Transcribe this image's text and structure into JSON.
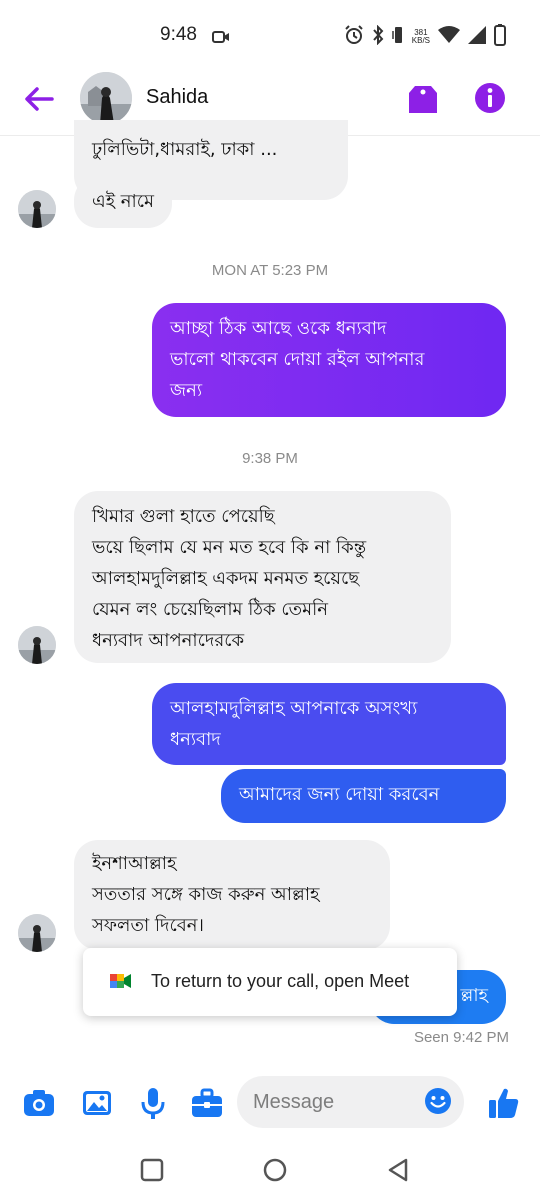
{
  "status_bar": {
    "time": "9:48",
    "network_speed_value": "381",
    "network_speed_unit": "KB/S",
    "icons": [
      "video-camera-icon",
      "alarm-icon",
      "bluetooth-icon",
      "vibrate-icon",
      "wifi-icon",
      "signal-icon",
      "battery-icon"
    ]
  },
  "header": {
    "contact_name": "Sahida",
    "back_icon": "back-arrow-icon",
    "tag_icon": "tag-icon",
    "info_icon": "info-icon"
  },
  "colors": {
    "accent_purple": "#8d20e6",
    "out_bubble_gradient_start": "#8a2ff0",
    "out_bubble_gradient_end": "#6f28f2",
    "out_bubble_blue": "#2f5df0",
    "incoming_bubble": "#f0f0f1",
    "like_blue": "#1877f2"
  },
  "messages": [
    {
      "id": "m0",
      "direction": "in",
      "text": "ঢুলিভিটা,ধামরাই, ঢাকা ..."
    },
    {
      "id": "m1",
      "direction": "in",
      "text": "এই নামে"
    },
    {
      "id": "t1",
      "type": "timestamp",
      "text": "MON AT 5:23 PM"
    },
    {
      "id": "m2",
      "direction": "out",
      "lines": [
        "আচ্ছা ঠিক আছে ওকে ধন্যবাদ",
        "ভালো থাকবেন দোয়া রইল আপনার",
        "জন্য"
      ]
    },
    {
      "id": "t2",
      "type": "timestamp",
      "text": "9:38 PM"
    },
    {
      "id": "m3",
      "direction": "in",
      "lines": [
        "খিমার গুলা হাতে পেয়েছি",
        "ভয়ে ছিলাম যে মন মত হবে কি না কিন্তু",
        "আলহামদুলিল্লাহ একদম মনমত হয়েছে",
        "যেমন লং চেয়েছিলাম ঠিক তেমনি",
        "ধন্যবাদ আপনাদেরকে"
      ]
    },
    {
      "id": "m4",
      "direction": "out",
      "lines": [
        "আলহামদুলিল্লাহ আপনাকে অসংখ্য",
        "ধন্যবাদ"
      ]
    },
    {
      "id": "m5",
      "direction": "out",
      "text": "আমাদের জন্য দোয়া করবেন"
    },
    {
      "id": "m6",
      "direction": "in",
      "lines": [
        "ইনশাআল্লাহ",
        "সততার সঙ্গে কাজ করুন আল্লাহ",
        "সফলতা দিবেন।"
      ]
    },
    {
      "id": "m7",
      "direction": "out",
      "text": "ল্লাহ"
    }
  ],
  "seen_status": "Seen 9:42 PM",
  "toast": {
    "text": "To return to your call, open Meet",
    "icon": "google-meet-icon"
  },
  "composer": {
    "placeholder": "Message",
    "buttons": [
      "camera-icon",
      "gallery-icon",
      "microphone-icon",
      "briefcase-icon",
      "emoji-icon",
      "like-icon"
    ]
  },
  "nav": [
    "recents-square-icon",
    "home-circle-icon",
    "back-triangle-icon"
  ]
}
